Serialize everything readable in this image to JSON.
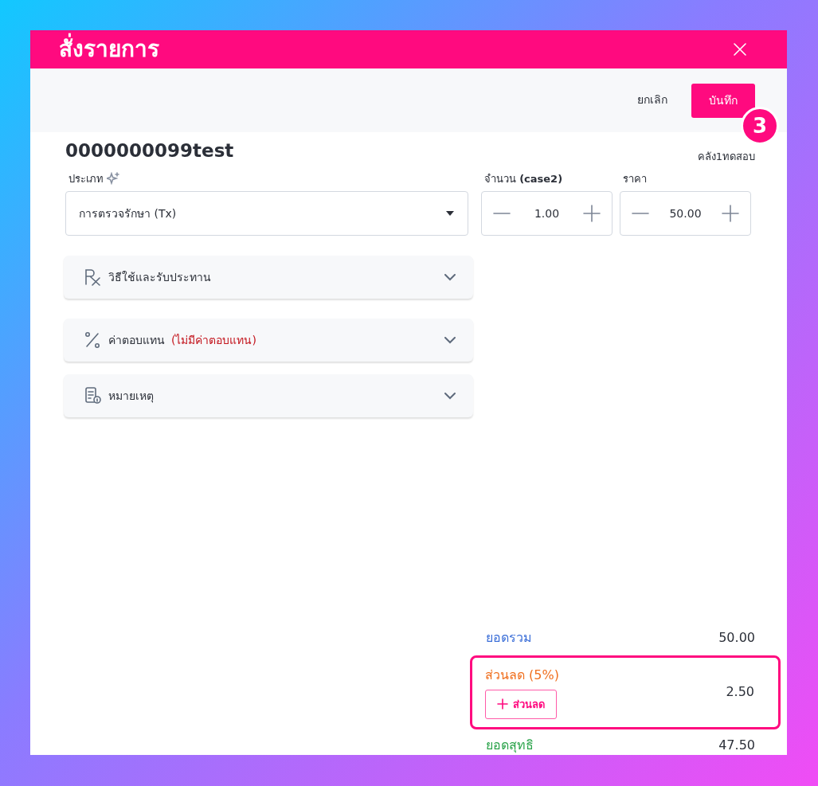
{
  "modal": {
    "title": "สั่งรายการ"
  },
  "toolbar": {
    "cancel": "ยกเลิก",
    "save": "บันทึก"
  },
  "step_badge": "3",
  "item": {
    "code": "0000000099test",
    "warehouse": "คลัง1ทดสอบ"
  },
  "type_field": {
    "label": "ประเภท",
    "value": "การตรวจรักษา (Tx)"
  },
  "quantity": {
    "label": "จำนวน **(case2)**",
    "value": "1.00"
  },
  "price": {
    "label": "ราคา",
    "value": "50.00"
  },
  "sections": [
    {
      "kind": "rx",
      "title": "วิธีใช้และรับประทาน",
      "expanded": false
    },
    {
      "kind": "percent",
      "title": "ค่าตอบแทน",
      "note": "(ไม่มีค่าตอบแทน)",
      "expanded": false
    },
    {
      "kind": "note",
      "title": "หมายเหตุ",
      "expanded": false
    }
  ],
  "summary": {
    "subtotal": {
      "label": "ยอดรวม",
      "value": "50.00"
    },
    "discount": {
      "label": "ส่วนลด (5%)",
      "value": "2.50",
      "button": "ส่วนลด",
      "highlighted": true
    },
    "net": {
      "label": "ยอดสุทธิ",
      "value": "47.50"
    }
  }
}
